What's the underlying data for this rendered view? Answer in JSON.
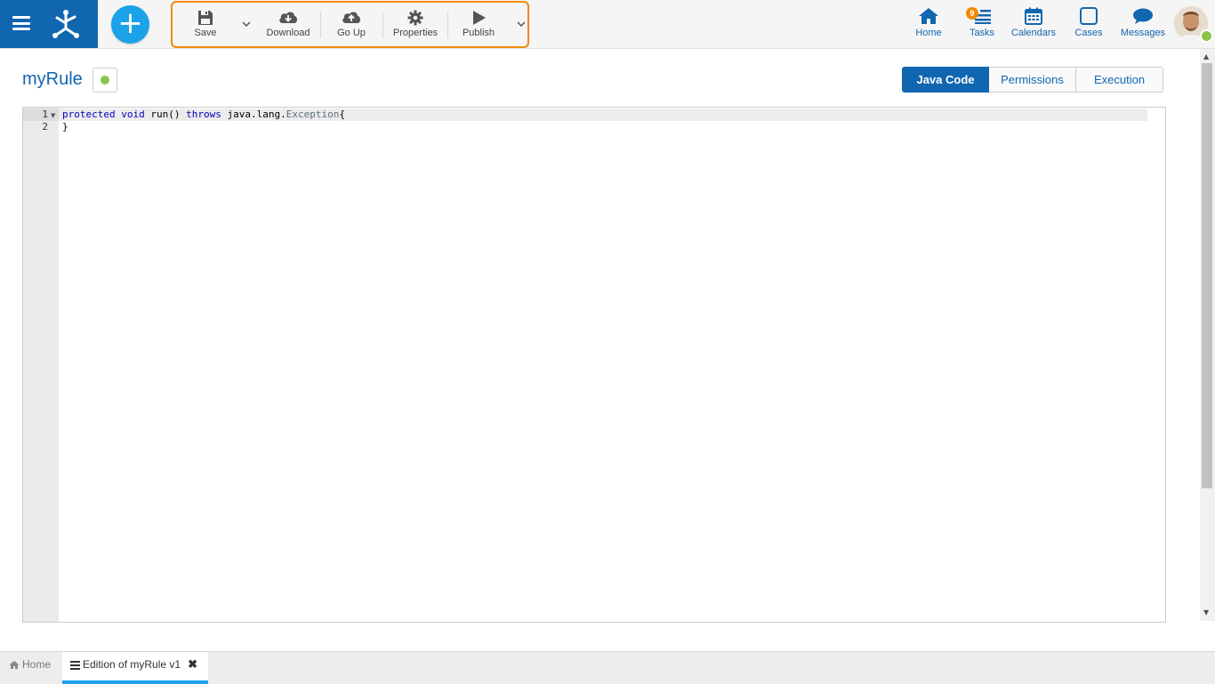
{
  "toolbar": {
    "save": "Save",
    "download": "Download",
    "go_up": "Go Up",
    "properties": "Properties",
    "publish": "Publish"
  },
  "nav": {
    "home": "Home",
    "tasks": "Tasks",
    "tasks_badge": "9",
    "calendars": "Calendars",
    "cases": "Cases",
    "messages": "Messages"
  },
  "page": {
    "title": "myRule",
    "status_color": "#8bc34a"
  },
  "tabs": {
    "java_code": "Java Code",
    "permissions": "Permissions",
    "execution": "Execution",
    "active": "Java Code"
  },
  "editor": {
    "line_numbers": [
      "1",
      "2"
    ],
    "line1": {
      "kw1": "protected",
      "kw2": "void",
      "t1": "run()",
      "kw3": "throws",
      "t2": "java.lang.",
      "cls": "Exception",
      "t3": "{"
    },
    "line2": "}"
  },
  "bottom_tabs": {
    "home": "Home",
    "edition": "Edition of myRule v1"
  },
  "colors": {
    "primary": "#1166b0",
    "accent": "#1aa3e8",
    "highlight": "#f08a00"
  }
}
